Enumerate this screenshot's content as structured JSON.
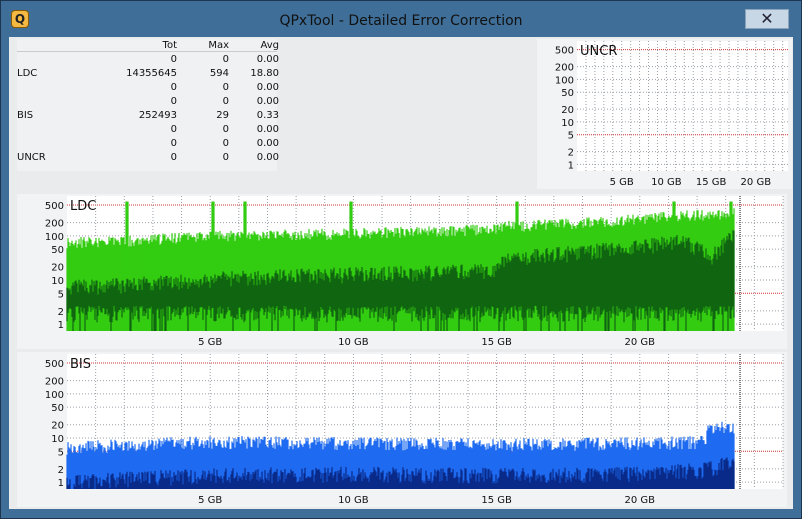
{
  "window": {
    "title": "QPxTool - Detailed Error Correction",
    "app_icon_glyph": "Q",
    "close_glyph": "✕"
  },
  "stats": {
    "headers": [
      "",
      "Tot",
      "Max",
      "Avg"
    ],
    "rows": [
      [
        "",
        "0",
        "0",
        "0.00"
      ],
      [
        "LDC",
        "14355645",
        "594",
        "18.80"
      ],
      [
        "",
        "0",
        "0",
        "0.00"
      ],
      [
        "",
        "0",
        "0",
        "0.00"
      ],
      [
        "BIS",
        "252493",
        "29",
        "0.33"
      ],
      [
        "",
        "0",
        "0",
        "0.00"
      ],
      [
        "",
        "0",
        "0",
        "0.00"
      ],
      [
        "UNCR",
        "0",
        "0",
        "0.00"
      ]
    ]
  },
  "chart_data": [
    {
      "name": "UNCR",
      "type": "area",
      "title": "UNCR",
      "y_scale": "log",
      "y_ticks": [
        "500",
        "200",
        "100",
        "50",
        "20",
        "10",
        "5",
        "2",
        "1"
      ],
      "x_ticks": [
        "5 GB",
        "10 GB",
        "15 GB",
        "20 GB"
      ],
      "xlim_gb": [
        0,
        23.6
      ],
      "red_lines": [
        500,
        5
      ],
      "series": [
        {
          "values": [
            0
          ]
        }
      ],
      "colors": {
        "fill": "#2fbf2f"
      }
    },
    {
      "name": "LDC",
      "type": "area",
      "title": "LDC",
      "y_scale": "log",
      "y_ticks": [
        "500",
        "200",
        "100",
        "50",
        "20",
        "10",
        "5",
        "2",
        "1"
      ],
      "x_ticks": [
        "5 GB",
        "10 GB",
        "15 GB",
        "20 GB"
      ],
      "xlim_gb": [
        0,
        25
      ],
      "red_lines": [
        500,
        5
      ],
      "series": [
        {
          "color": "#33cc11",
          "x": [
            0,
            2,
            5,
            8,
            10,
            12,
            15,
            15.3,
            18,
            20,
            21.5,
            22.5,
            23.3
          ],
          "values": [
            70,
            75,
            95,
            105,
            110,
            120,
            140,
            160,
            190,
            230,
            280,
            300,
            320
          ]
        },
        {
          "color": "#116611",
          "x": [
            0,
            2,
            5,
            8,
            10,
            12,
            15,
            15.3,
            18,
            20,
            21.5,
            22.5,
            23.3
          ],
          "values": [
            7,
            8,
            11,
            13,
            14,
            15,
            17,
            30,
            45,
            60,
            80,
            30,
            100
          ]
        }
      ],
      "spikes_gb": [
        2.1,
        5.1,
        6.2,
        9.9,
        15.7,
        21.2,
        23.2
      ],
      "end_marker_gb": 23.5
    },
    {
      "name": "BIS",
      "type": "area",
      "title": "BIS",
      "y_scale": "log",
      "y_ticks": [
        "500",
        "200",
        "100",
        "50",
        "20",
        "10",
        "5",
        "2",
        "1"
      ],
      "x_ticks": [
        "5 GB",
        "10 GB",
        "15 GB",
        "20 GB"
      ],
      "xlim_gb": [
        0,
        25
      ],
      "red_lines": [
        500,
        5
      ],
      "series": [
        {
          "color": "#1e6af0",
          "x": [
            0,
            2.5,
            5,
            10,
            15,
            20,
            22.3,
            22.35,
            23.3
          ],
          "values": [
            6,
            7,
            8,
            7.5,
            7,
            7.5,
            8,
            15,
            18
          ]
        },
        {
          "color": "#0a2a8a",
          "x": [
            0,
            2.5,
            5,
            10,
            15,
            20,
            22.3,
            23.3
          ],
          "values": [
            1,
            1.3,
            1.5,
            1.6,
            1.5,
            1.6,
            2,
            3
          ]
        }
      ],
      "end_marker_gb": 23.5
    }
  ]
}
